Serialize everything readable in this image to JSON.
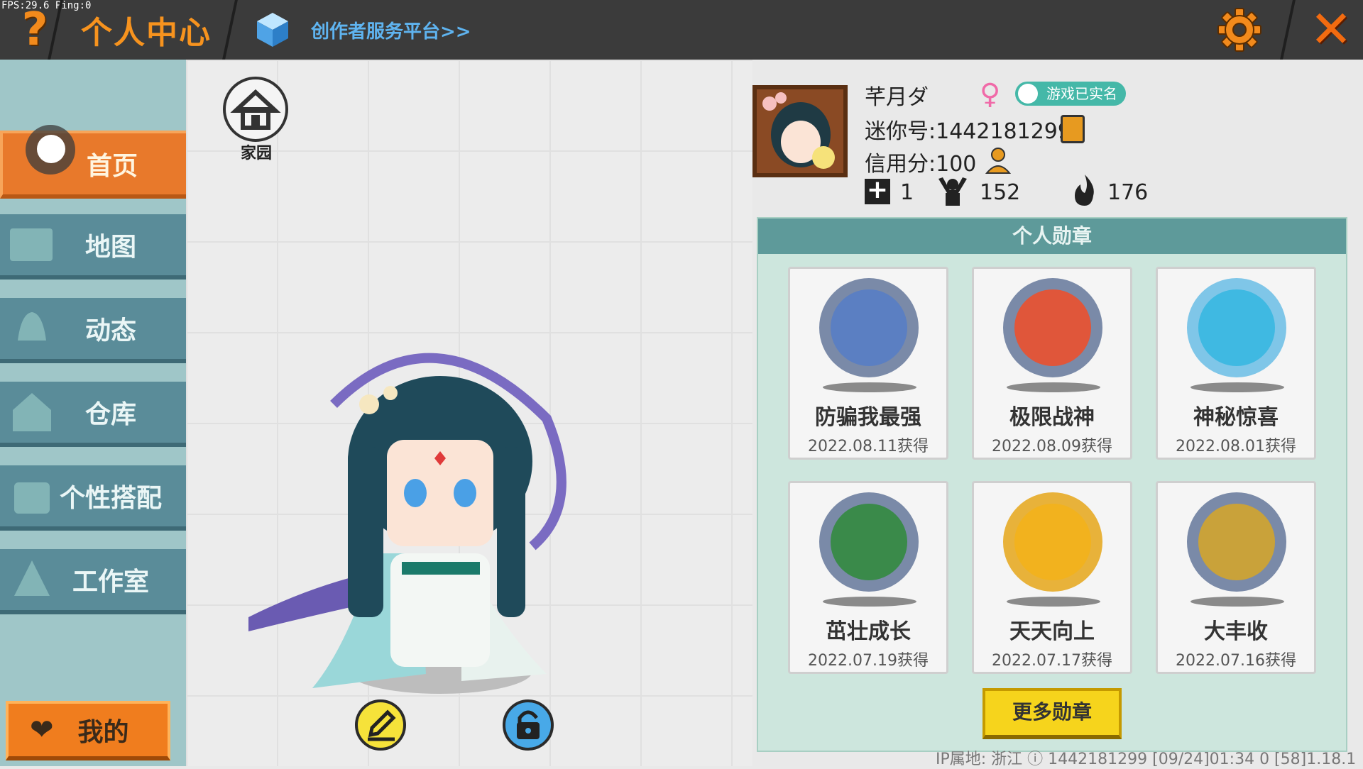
{
  "overlay": {
    "fps": "FPS:29.6  Ping:0"
  },
  "topbar": {
    "help": "?",
    "title": "个人中心",
    "creator_link": "创作者服务平台>>",
    "close": "✕"
  },
  "sidebar": {
    "items": [
      {
        "label": "首页",
        "icon": "toggle-icon",
        "active": true
      },
      {
        "label": "地图",
        "icon": "map-icon",
        "active": false
      },
      {
        "label": "动态",
        "icon": "bell-icon",
        "active": false
      },
      {
        "label": "仓库",
        "icon": "house-icon",
        "active": false
      },
      {
        "label": "个性搭配",
        "icon": "outfit-icon",
        "active": false
      },
      {
        "label": "工作室",
        "icon": "tree-icon",
        "active": false
      }
    ],
    "my_label": "我的"
  },
  "stage": {
    "home_label": "家园"
  },
  "profile": {
    "nickname": "芊月ダ",
    "gender": "♀",
    "verified": "游戏已实名",
    "mini_id": "迷你号:1442181299",
    "credit": "信用分:100",
    "stats": {
      "add": "1",
      "likes": "152",
      "fire": "176"
    }
  },
  "medals": {
    "title": "个人勋章",
    "items": [
      {
        "name": "防骗我最强",
        "date": "2022.08.11获得",
        "color": "#5b7fc2"
      },
      {
        "name": "极限战神",
        "date": "2022.08.09获得",
        "color": "#e0563a"
      },
      {
        "name": "神秘惊喜",
        "date": "2022.08.01获得",
        "color": "#3fb9e2"
      },
      {
        "name": "茁壮成长",
        "date": "2022.07.19获得",
        "color": "#3a8a4a"
      },
      {
        "name": "天天向上",
        "date": "2022.07.17获得",
        "color": "#f2b21e"
      },
      {
        "name": "大丰收",
        "date": "2022.07.16获得",
        "color": "#c9a23a"
      }
    ],
    "more_label": "更多勋章"
  },
  "footer": {
    "text": "IP属地: 浙江 ⓘ     1442181299    [09/24]01:34 0   [58]1.18.1"
  }
}
